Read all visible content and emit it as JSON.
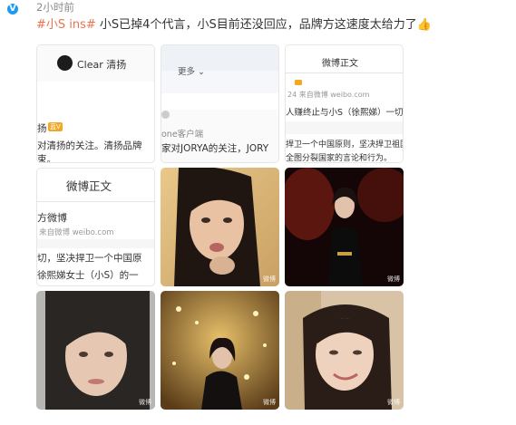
{
  "post": {
    "time": "2小时前",
    "tag": "#小S ins#",
    "text": " 小S已掉4个代言，小S目前还没回应，品牌方这速度太给力了",
    "emoji": "👍"
  },
  "images": {
    "img1": {
      "brand": "Clear 清扬",
      "line1": "扬",
      "badge": "蓝V",
      "line2": "对清扬的关注。清扬品牌",
      "line3": "束。"
    },
    "img2": {
      "more": "更多",
      "client": "one客户端",
      "line": "家对JORYA的关注，JORY"
    },
    "img3": {
      "title": "微博正文",
      "meta": "24 来自微博 weibo.com",
      "line1": "人赚终止与小S（徐熙娣）一切",
      "line2": "捍卫一个中国原则，坚决捍卫祖国",
      "line3": "全图分裂国家的言论和行为。"
    },
    "img4": {
      "title": "微博正文",
      "name": "方微博",
      "meta": "来自微博 weibo.com",
      "line1": "切，坚决捍卫一个中国原",
      "line2": "徐熙娣女士（小S）的一"
    },
    "img5": {
      "watermark": "微博"
    },
    "img6": {
      "watermark": "微博"
    },
    "img7": {
      "watermark": "微博"
    },
    "img8": {
      "watermark": "微博"
    },
    "img9": {
      "watermark": "微博"
    }
  },
  "colors": {
    "tag": "#eb7350",
    "vip": "#1e9bf0",
    "time": "#8a8a8a"
  }
}
